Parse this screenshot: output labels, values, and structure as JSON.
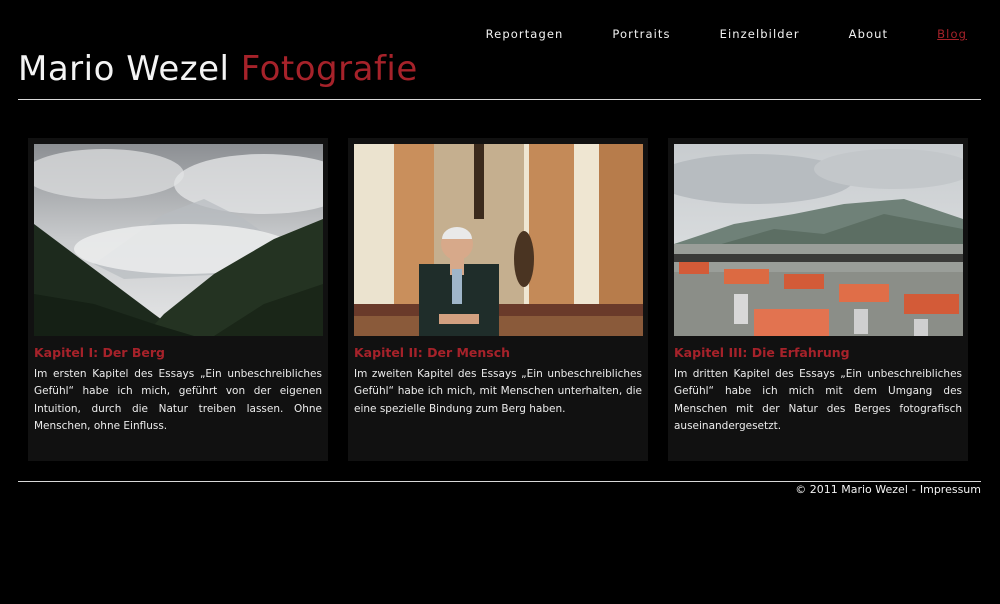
{
  "nav": [
    {
      "label": "Reportagen",
      "active": false
    },
    {
      "label": "Portraits",
      "active": false
    },
    {
      "label": "Einzelbilder",
      "active": false
    },
    {
      "label": "About",
      "active": false
    },
    {
      "label": "Blog",
      "active": true
    }
  ],
  "brand": {
    "name": "Mario Wezel",
    "accent": "Fotografie",
    "accent_color": "#a6222a"
  },
  "cards": [
    {
      "title": "Kapitel I: Der Berg",
      "text": "Im ersten Kapitel des Essays „Ein unbeschreibliches Gefühl“ habe ich mich, geführt von der eigenen Intuition, durch die Natur treiben lassen. Ohne Menschen, ohne Einfluss."
    },
    {
      "title": "Kapitel II: Der Mensch",
      "text": "Im zweiten Kapitel des Essays „Ein unbeschreibliches Gefühl“ habe ich mich, mit Menschen unterhalten, die eine spezielle Bindung zum Berg haben."
    },
    {
      "title": "Kapitel III: Die Erfahrung",
      "text": "Im dritten Kapitel des Essays „Ein unbeschreibliches Gefühl“ habe ich mich mit dem Umgang des Menschen mit der Natur des Berges fotografisch auseinandergesetzt."
    }
  ],
  "footer": {
    "copyright": "© 2011 Mario Wezel",
    "separator": "-",
    "link": "Impressum"
  }
}
